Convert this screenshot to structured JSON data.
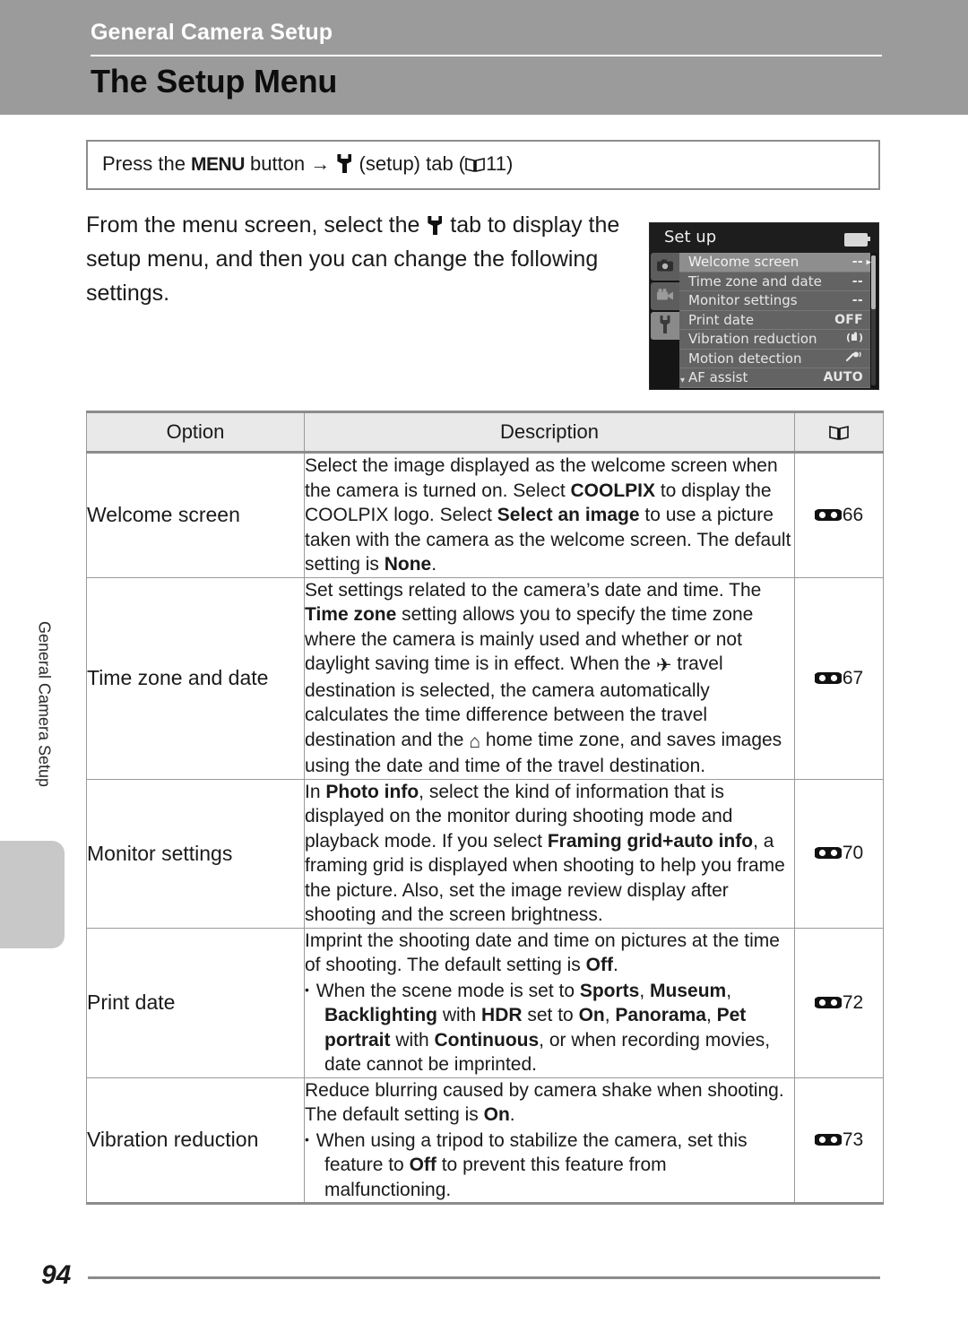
{
  "header": {
    "chapter": "General Camera Setup",
    "title": "The Setup Menu"
  },
  "side_tab": {
    "label": "General Camera Setup"
  },
  "instruction": {
    "before_menu": "Press the ",
    "menu_label": "MENU",
    "after_menu": " button ",
    "arrow": "→",
    "setup_icon": "wrench-icon",
    "setup_text": "(setup) tab (",
    "book_icon": "book-icon",
    "page_ref": "11)"
  },
  "body": {
    "paragraph_part1": "From the menu screen, select the ",
    "paragraph_icon": "wrench-icon",
    "paragraph_part2": " tab to display the setup menu, and then you can change the following settings."
  },
  "camera_screen": {
    "title": "Set up",
    "battery_icon": "battery-icon",
    "tabs": [
      {
        "name": "shooting-tab",
        "icon": "camera-icon",
        "active": false
      },
      {
        "name": "movie-tab",
        "icon": "movie-camera-icon",
        "active": false
      },
      {
        "name": "setup-tab",
        "icon": "wrench-icon",
        "active": true
      }
    ],
    "rows": [
      {
        "label": "Welcome screen",
        "value": "--",
        "selected": true,
        "chevron": "▸"
      },
      {
        "label": "Time zone and date",
        "value": "--",
        "selected": false,
        "chevron": ""
      },
      {
        "label": "Monitor settings",
        "value": "--",
        "selected": false,
        "chevron": ""
      },
      {
        "label": "Print date",
        "value": "OFF",
        "selected": false,
        "chevron": ""
      },
      {
        "label": "Vibration reduction",
        "value": "vr-hand-icon",
        "selected": false,
        "chevron": ""
      },
      {
        "label": "Motion detection",
        "value": "motion-icon",
        "selected": false,
        "chevron": ""
      },
      {
        "label": "AF assist",
        "value": "AUTO",
        "selected": false,
        "chevron": ""
      }
    ],
    "scroll_down_arrow": "▾"
  },
  "table": {
    "headers": {
      "option": "Option",
      "description": "Description",
      "reference": "book-icon"
    },
    "rows": [
      {
        "option": "Welcome screen",
        "reference": "66",
        "description_html": "Select the image displayed as the welcome screen when the camera is turned on. Select <span class=\"b\">COOLPIX</span> to display the COOLPIX logo. Select <span class=\"b\">Select an image</span> to use a picture taken with the camera as the welcome screen. The default setting is <span class=\"b\">None</span>."
      },
      {
        "option": "Time zone and date",
        "reference": "67",
        "description_html": "Set settings related to the camera’s date and time. The <span class=\"b\">Time zone</span> setting allows you to specify the time zone where the camera is mainly used and whether or not daylight saving time is in effect. When the <span class=\"plane\">✈</span> travel destination is selected, the camera automatically calculates the time difference between the travel destination and the <span class=\"home\">⌂</span> home time zone, and saves images using the date and time of the travel destination."
      },
      {
        "option": "Monitor settings",
        "reference": "70",
        "description_html": "In <span class=\"b\">Photo info</span>, select the kind of information that is displayed on the monitor during shooting mode and playback mode. If you select <span class=\"b\">Framing grid+auto info</span>, a framing grid is displayed when shooting to help you frame the picture. Also, set the image review display after shooting and the screen brightness."
      },
      {
        "option": "Print date",
        "reference": "72",
        "description_html": "Imprint the shooting date and time on pictures at the time of shooting. The default setting is <span class=\"b\">Off</span>.<span class=\"bullet-line\">When the scene mode is set to <span class=\"b\">Sports</span>, <span class=\"b\">Museum</span>, <span class=\"b\">Backlighting</span> with <span class=\"b\">HDR</span> set to <span class=\"b\">On</span>, <span class=\"b\">Panorama</span>, <span class=\"b\">Pet portrait</span> with <span class=\"b\">Continuous</span>, or when recording movies, date cannot be imprinted.</span>"
      },
      {
        "option": "Vibration reduction",
        "reference": "73",
        "description_html": "Reduce blurring caused by camera shake when shooting. The default setting is <span class=\"b\">On</span>.<span class=\"bullet-line\">When using a tripod to stabilize the camera, set this feature to <span class=\"b\">Off</span> to prevent this feature from malfunctioning.</span>"
      }
    ]
  },
  "footer": {
    "page_number": "94"
  },
  "colors": {
    "header_band": "#9b9b9b",
    "side_tab": "#c8c8c8",
    "table_header_bg": "#e9e9e9",
    "rule": "#8c8c8c",
    "camera_screen_bg": "#151515"
  }
}
